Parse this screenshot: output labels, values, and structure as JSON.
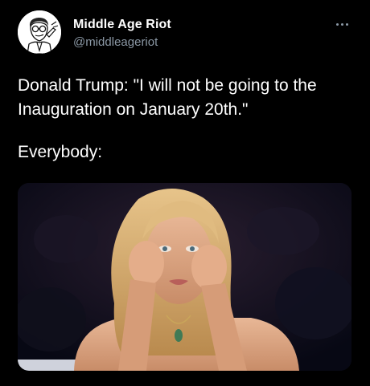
{
  "tweet": {
    "author": {
      "display_name": "Middle Age Riot",
      "handle": "@middleageriot",
      "avatar_icon": "cartoon-man-avatar"
    },
    "more_icon": "more-horizontal-icon",
    "text_line_1": "Donald Trump: \"I will not be going to the\nInauguration on January 20th.\"",
    "text_line_2": "Everybody:",
    "media": {
      "kind": "photo",
      "subject": "woman-rubbing-eyes-crying"
    }
  },
  "colors": {
    "background": "#000000",
    "text": "#ffffff",
    "secondary_text": "#8b98a5"
  }
}
